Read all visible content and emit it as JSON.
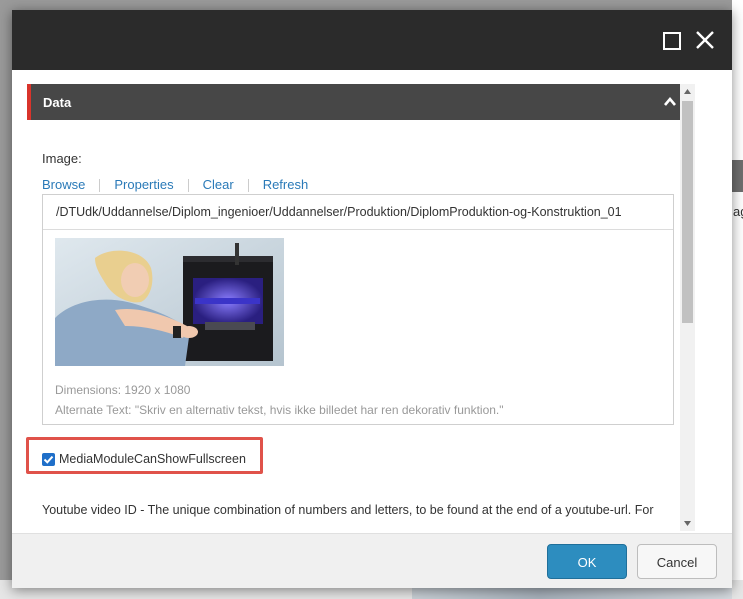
{
  "dialog": {
    "section_title": "Data",
    "image_field": {
      "label": "Image:",
      "links": [
        "Browse",
        "Properties",
        "Clear",
        "Refresh"
      ],
      "path": "/DTUdk/Uddannelse/Diplom_ingenioer/Uddannelser/Produktion/DiplomProduktion-og-Konstruktion_01",
      "dimensions": "Dimensions: 1920 x 1080",
      "alternate_text": "Alternate Text: \"Skriv en alternativ tekst, hvis ikke billedet har ren dekorativ funktion.\""
    },
    "checkbox": {
      "label": "MediaModuleCanShowFullscreen",
      "checked": true
    },
    "youtube_help": "Youtube video ID - The unique combination of numbers and letters, to be found at the end of a youtube-url. For",
    "buttons": {
      "ok": "OK",
      "cancel": "Cancel"
    }
  },
  "background": {
    "partial_text": "ag"
  },
  "colors": {
    "titlebar": "#2b2b2b",
    "section_header": "#474747",
    "section_accent": "#d9342b",
    "link": "#2a7ab8",
    "ok_button": "#2d8dbf",
    "highlight_border": "#e0524a"
  },
  "icons": [
    "maximize-icon",
    "close-icon",
    "chevron-up-icon",
    "checkmark-icon",
    "scroll-up-icon",
    "scroll-down-icon"
  ]
}
